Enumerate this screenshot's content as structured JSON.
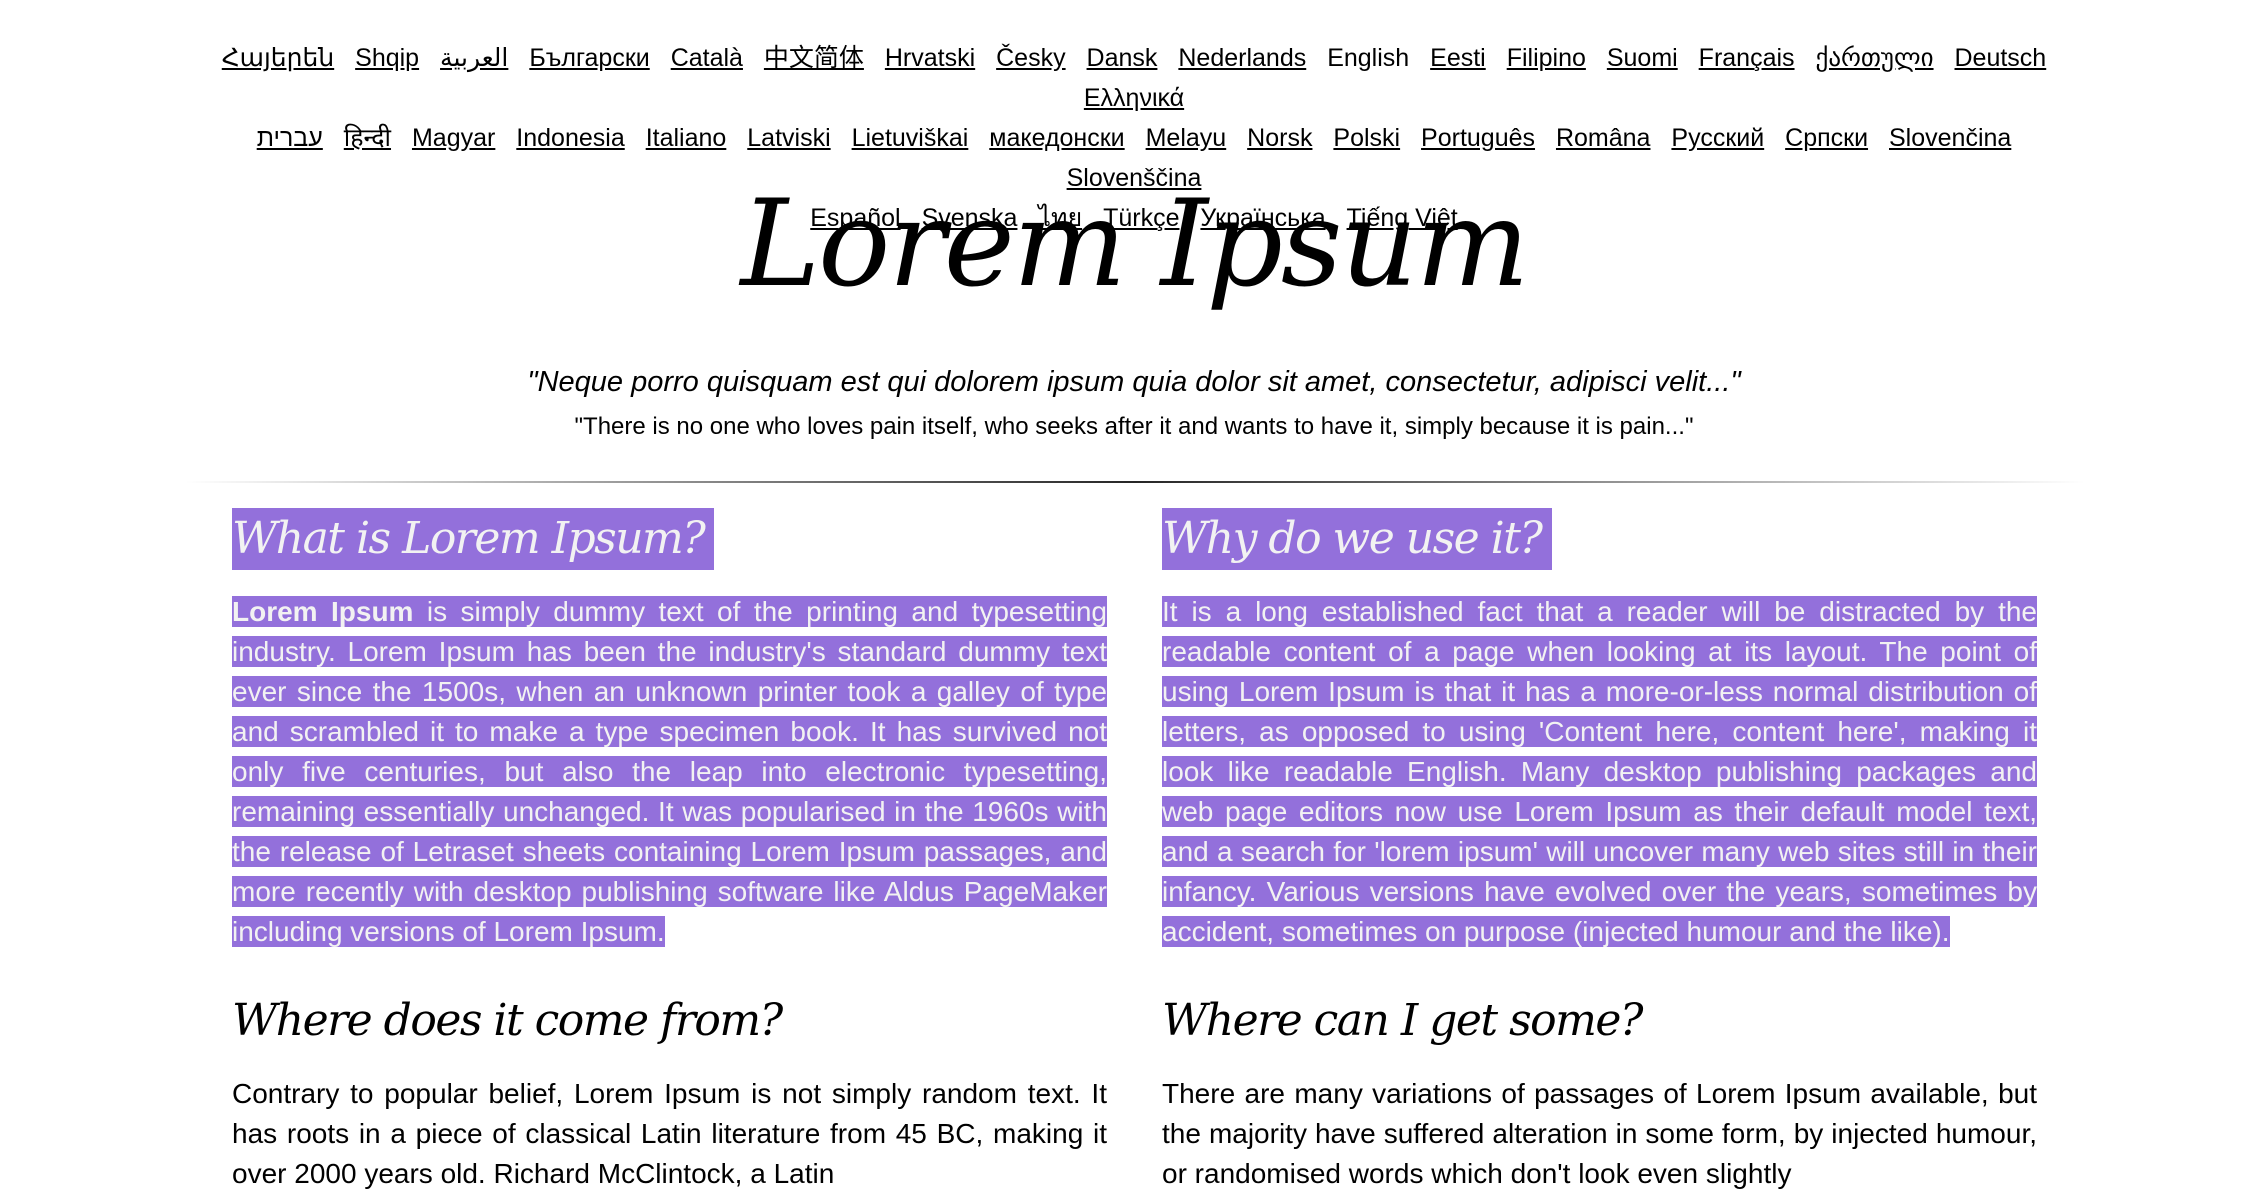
{
  "languages": {
    "rows": [
      [
        "Հայերեն",
        "Shqip",
        "العربية",
        "Български",
        "Català",
        "中文简体",
        "Hrvatski",
        "Česky",
        "Dansk",
        "Nederlands",
        "English",
        "Eesti",
        "Filipino",
        "Suomi",
        "Français",
        "ქართული",
        "Deutsch",
        "Ελληνικά"
      ],
      [
        "עברית",
        "हिन्दी",
        "Magyar",
        "Indonesia",
        "Italiano",
        "Latviski",
        "Lietuviškai",
        "македонски",
        "Melayu",
        "Norsk",
        "Polski",
        "Português",
        "Româna",
        "Русский",
        "Српски",
        "Slovenčina",
        "Slovenščina"
      ],
      [
        "Español",
        "Svenska",
        "ไทย",
        "Türkçe",
        "Українська",
        "Tiếng Việt"
      ]
    ],
    "current": "English"
  },
  "header": {
    "title": "Lorem Ipsum",
    "quote_latin": "\"Neque porro quisquam est qui dolorem ipsum quia dolor sit amet, consectetur, adipisci velit...\"",
    "quote_english": "\"There is no one who loves pain itself, who seeks after it and wants to have it, simply because it is pain...\""
  },
  "sections": {
    "what": {
      "heading": "What is Lorem Ipsum?",
      "bold_lead": "Lorem Ipsum",
      "body": " is simply dummy text of the printing and typesetting industry. Lorem Ipsum has been the industry's standard dummy text ever since the 1500s, when an unknown printer took a galley of type and scrambled it to make a type specimen book. It has survived not only five centuries, but also the leap into electronic typesetting, remaining essentially unchanged. It was popularised in the 1960s with the release of Letraset sheets containing Lorem Ipsum passages, and more recently with desktop publishing software like Aldus PageMaker including versions of Lorem Ipsum."
    },
    "why": {
      "heading": "Why do we use it?",
      "body": "It is a long established fact that a reader will be distracted by the readable content of a page when looking at its layout. The point of using Lorem Ipsum is that it has a more-or-less normal distribution of letters, as opposed to using 'Content here, content here', making it look like readable English. Many desktop publishing packages and web page editors now use Lorem Ipsum as their default model text, and a search for 'lorem ipsum' will uncover many web sites still in their infancy. Various versions have evolved over the years, sometimes by accident, sometimes on purpose (injected humour and the like)."
    },
    "where_from": {
      "heading": "Where does it come from?",
      "body": "Contrary to popular belief, Lorem Ipsum is not simply random text. It has roots in a piece of classical Latin literature from 45 BC, making it over 2000 years old. Richard McClintock, a Latin"
    },
    "where_get": {
      "heading": "Where can I get some?",
      "body": "There are many variations of passages of Lorem Ipsum available, but the majority have suffered alteration in some form, by injected humour, or randomised words which don't look even slightly"
    }
  },
  "colors": {
    "selection_highlight": "#9370DB",
    "selection_text": "#F2F2F2"
  }
}
